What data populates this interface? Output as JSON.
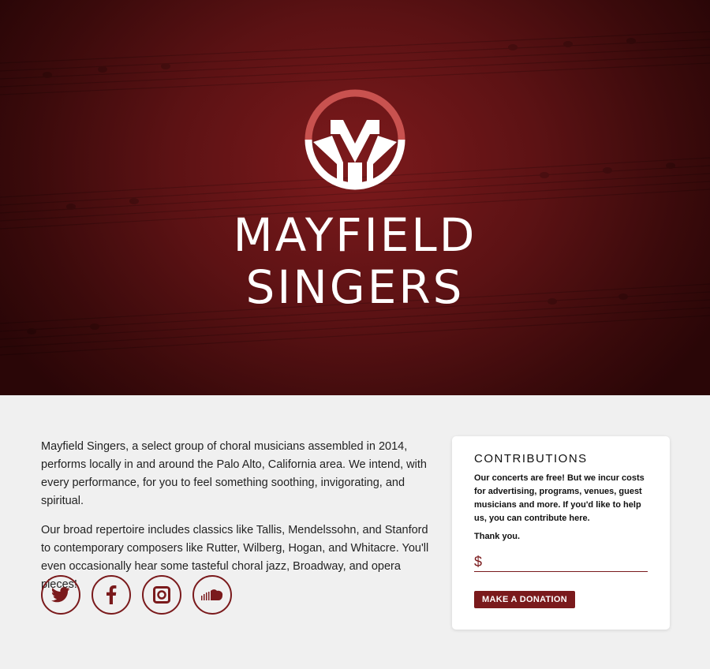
{
  "hero": {
    "brand_line1": "MAYFIELD",
    "brand_line2": "SINGERS",
    "background_color": "#6b1517",
    "logo": "mayfield-m-circle-logo"
  },
  "about": {
    "paragraph1": "Mayfield Singers, a select group of choral musicians assembled in 2014, performs locally in and around the Palo Alto, California area. We intend, with every performance, for you to feel something soothing, invigorating, and spiritual.",
    "paragraph2": "Our broad repertoire includes classics like Tallis, Mendelssohn, and Stanford to contemporary composers like Rutter, Wilberg, Hogan, and Whitacre. You'll even occasionally hear some tasteful choral jazz, Broadway, and opera pieces!"
  },
  "socials": [
    {
      "icon": "twitter-icon"
    },
    {
      "icon": "facebook-icon"
    },
    {
      "icon": "instagram-icon"
    },
    {
      "icon": "soundcloud-icon"
    }
  ],
  "contributions": {
    "title": "CONTRIBUTIONS",
    "body": "Our concerts are free! But we incur costs for advertising, programs, venues, guest musicians and more. If you'd like to help us, you can contribute here.",
    "thanks": "Thank you.",
    "currency_symbol": "$",
    "amount_value": "",
    "button_label": "MAKE A DONATION"
  },
  "colors": {
    "accent": "#7a1a1c",
    "page_bg": "#f0f0f0"
  }
}
